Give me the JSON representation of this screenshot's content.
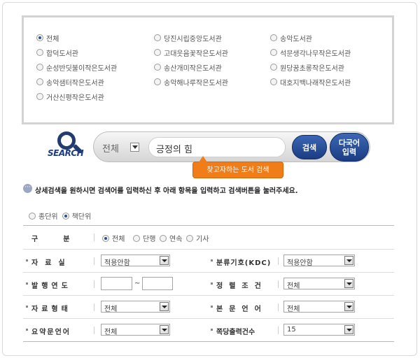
{
  "libraries": [
    {
      "label": "전체",
      "checked": true
    },
    {
      "label": "당진시립중앙도서관",
      "checked": false
    },
    {
      "label": "송악도서관",
      "checked": false
    },
    {
      "label": "합덕도서관",
      "checked": false
    },
    {
      "label": "고대웃음꽃작은도서관",
      "checked": false
    },
    {
      "label": "석문생각나무작은도서관",
      "checked": false
    },
    {
      "label": "순성반딧불이작은도서관",
      "checked": false
    },
    {
      "label": "송산개미작은도서관",
      "checked": false
    },
    {
      "label": "원당꿈초롱작은도서관",
      "checked": false
    },
    {
      "label": "송악샘터작은도서관",
      "checked": false
    },
    {
      "label": "송악해나루작은도서관",
      "checked": false
    },
    {
      "label": "대호지백나래작은도서관",
      "checked": false
    },
    {
      "label": "거산신평작은도서관",
      "checked": false
    }
  ],
  "search": {
    "logo_text": "SEARCH",
    "scope": "전체",
    "query": "긍정의 힘",
    "search_button": "검색",
    "multilang_button_line1": "다국어",
    "multilang_button_line2": "입력",
    "tooltip": "찾고자하는 도서 검색"
  },
  "detail": {
    "icon_text": "···",
    "instruction": "상세검색을 원하시면 검색어를 입력하신 후 아래 항목을 입력하고 검색버튼을 눌러주세요."
  },
  "unit": {
    "options": [
      {
        "label": "종단위",
        "checked": false
      },
      {
        "label": "책단위",
        "checked": true
      }
    ]
  },
  "form": {
    "category_label": "구분",
    "category_options": [
      {
        "label": "전체",
        "checked": true
      },
      {
        "label": "단행",
        "checked": false
      },
      {
        "label": "연속",
        "checked": false
      },
      {
        "label": "기사",
        "checked": false
      }
    ],
    "location_label": "자료실",
    "location_value": "적용안함",
    "kdc_label": "분류기호(KDC)",
    "kdc_value": "적용안함",
    "year_label": "발행연도",
    "year_tilde": "~",
    "sort_label": "정렬조건",
    "sort_value": "전체",
    "type_label": "자료형태",
    "type_value": "전체",
    "lang_label": "본문언어",
    "lang_value": "전체",
    "summary_lang_label": "요약문언어",
    "summary_lang_value": "전체",
    "per_page_label": "쪽당출력건수",
    "per_page_value": "15"
  }
}
